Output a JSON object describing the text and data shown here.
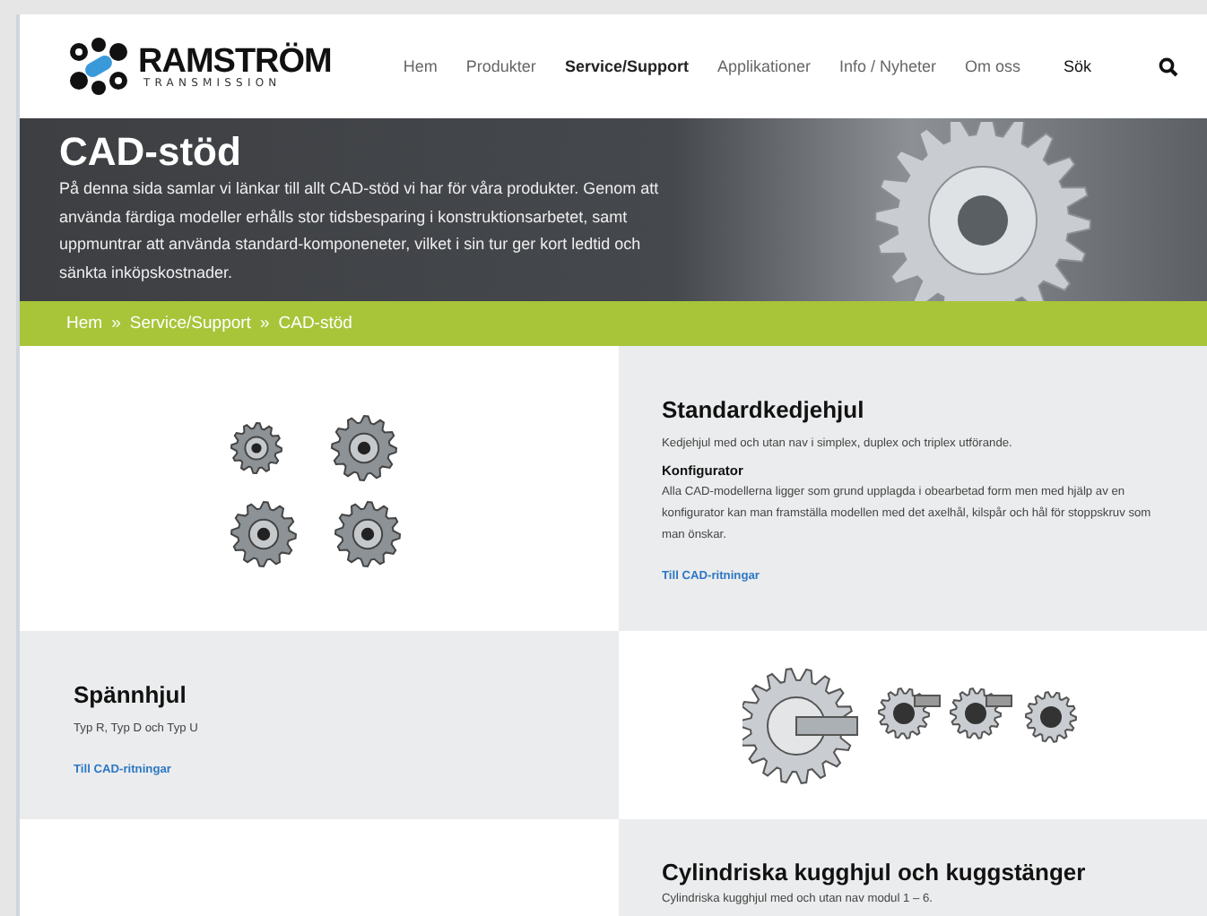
{
  "header": {
    "logo": {
      "name": "RAMSTRÖM",
      "tagline": "TRANSMISSION"
    },
    "nav": [
      {
        "label": "Hem",
        "selected": false
      },
      {
        "label": "Produkter",
        "selected": false
      },
      {
        "label": "Service/Support",
        "selected": true
      },
      {
        "label": "Applikationer",
        "selected": false
      },
      {
        "label": "Info / Nyheter",
        "selected": false
      },
      {
        "label": "Om oss",
        "selected": false
      }
    ],
    "search": {
      "label": "Sök"
    }
  },
  "hero": {
    "title": "CAD-stöd",
    "text": "På denna sida samlar vi länkar till allt CAD-stöd vi har för våra produkter. Genom att använda färdiga modeller erhålls stor tidsbesparing i konstruktionsarbetet, samt uppmuntrar att använda standard-komponeneter, vilket i sin tur ger kort ledtid och sänkta inköpskostnader."
  },
  "breadcrumb": [
    "Hem",
    "Service/Support",
    "CAD-stöd"
  ],
  "breadcrumb_separator": "»",
  "products": [
    {
      "title": "Standardkedjehjul",
      "description": "Kedjehjul med och utan nav i simplex, duplex och triplex utförande.",
      "subheading": "Konfigurator",
      "body": "Alla CAD-modellerna ligger som grund upplagda i obearbetad form men med hjälp av en konfigurator kan man framställa modellen med det axelhål, kilspår och hål för stoppskruv som man önskar.",
      "link": "Till CAD-ritningar"
    },
    {
      "title": "Spännhjul",
      "description": "Typ R, Typ D och Typ U",
      "link": "Till CAD-ritningar"
    },
    {
      "title": "Cylindriska kugghjul och kuggstänger",
      "description": "Cylindriska kugghjul med och utan nav modul 1 – 6."
    }
  ]
}
